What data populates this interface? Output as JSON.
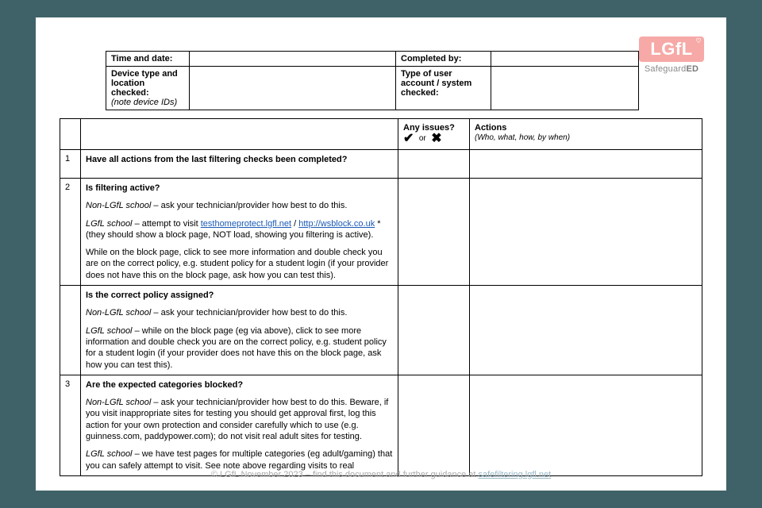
{
  "logo": {
    "brand": "LGfL",
    "sub_a": "Safeguard",
    "sub_b": "ED"
  },
  "meta": {
    "row1": {
      "label1": "Time and date:",
      "val1": "",
      "label2": "Completed by:",
      "val2": ""
    },
    "row2": {
      "label1a": "Device type and location checked:",
      "label1b": "(note device IDs)",
      "val1": "",
      "label2": "Type of user account / system checked:",
      "val2": ""
    }
  },
  "headers": {
    "issues": "Any issues?",
    "issues_or": "or",
    "actions": "Actions",
    "actions_sub": "(Who, what, how, by when)"
  },
  "rows": {
    "r1": {
      "num": "1",
      "title": "Have all actions from the last filtering checks been completed?"
    },
    "r2a": {
      "num": "2",
      "title": "Is filtering active?",
      "p1_prefix": "Non-LGfL school",
      "p1_rest": " – ask your technician/provider how best to do this.",
      "p2_prefix": "LGfL school",
      "p2_mid": " – attempt to visit ",
      "link1": "testhomeprotect.lgfl.net",
      "sep": " / ",
      "link2": "http://wsblock.co.uk",
      "p2_end": " * (they should show a block page, NOT load, showing you filtering is active).",
      "p3": "While on the block page, click to see more information and double check you are on the correct policy, e.g. student policy for a student login (if your provider does not have this on the block page, ask how you can test this)."
    },
    "r2b": {
      "title": "Is the correct policy assigned?",
      "p1_prefix": "Non-LGfL school",
      "p1_rest": " – ask your technician/provider how best to do this.",
      "p2_prefix": "LGfL school",
      "p2_rest": " – while on the block page (eg via above), click to see more information and double check you are on the correct policy, e.g. student policy for a student login (if your provider does not have this on the block page, ask how you can test this)."
    },
    "r3": {
      "num": "3",
      "title": "Are the expected categories blocked?",
      "p1_prefix": "Non-LGfL school",
      "p1_rest": " – ask your technician/provider how best to do this. Beware, if you visit inappropriate sites for testing you should get approval first, log this action for your own protection and consider carefully which to use (e.g. guinness.com, paddypower.com); do not visit real adult sites for testing.",
      "p2_prefix": "LGfL school",
      "p2_rest": " – we have test pages for multiple categories (eg adult/gaming) that you can safely attempt to visit. See note above regarding visits to real"
    }
  },
  "footer": {
    "text_a": "© LGfL November 2023  – find this document and further guidance at ",
    "link": "safefiltering.lgfl.net"
  }
}
